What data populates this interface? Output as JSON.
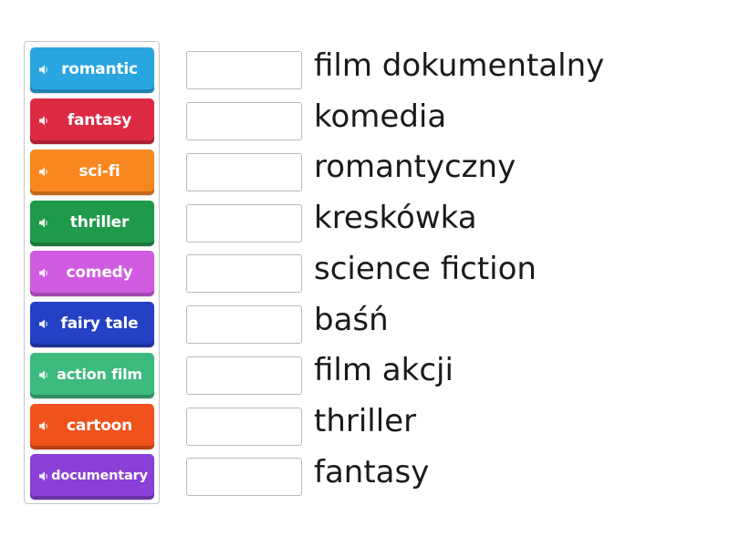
{
  "tiles": [
    {
      "label": "romantic",
      "color": "#29a6e0"
    },
    {
      "label": "fantasy",
      "color": "#dd2a43"
    },
    {
      "label": "sci-fi",
      "color": "#f8871f"
    },
    {
      "label": "thriller",
      "color": "#1f9a4b"
    },
    {
      "label": "comedy",
      "color": "#d05be0"
    },
    {
      "label": "fairy tale",
      "color": "#2440c4"
    },
    {
      "label": "action film",
      "color": "#3dba7d"
    },
    {
      "label": "cartoon",
      "color": "#f0521c"
    },
    {
      "label": "documentary",
      "color": "#8a3fd6"
    }
  ],
  "targets": [
    "film dokumentalny",
    "komedia",
    "romantyczny",
    "kreskówka",
    "science fiction",
    "baśń",
    "film akcji",
    "thriller",
    "fantasy"
  ],
  "icons": {
    "tile_icon": "speaker-icon"
  }
}
